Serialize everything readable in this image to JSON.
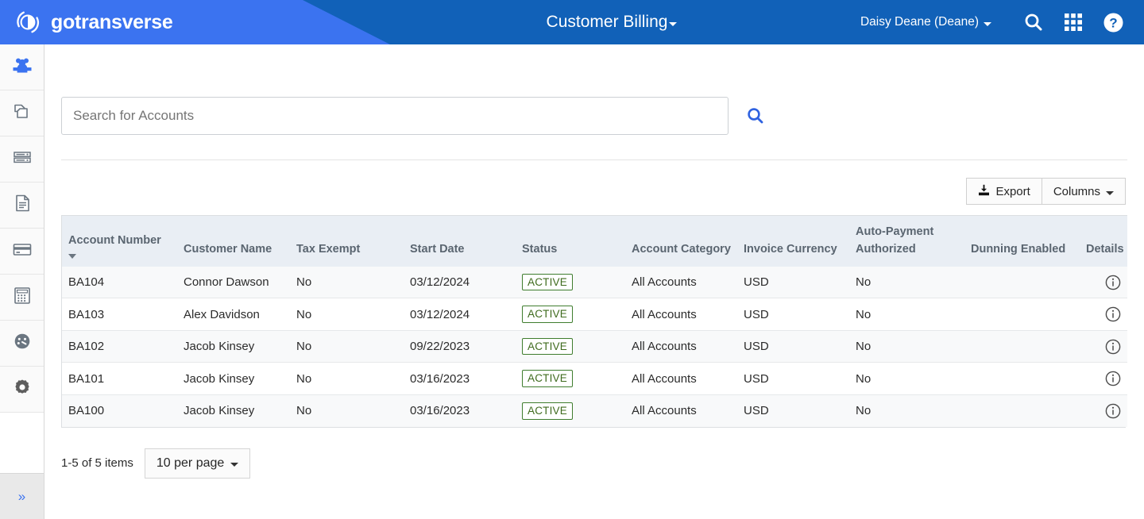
{
  "header": {
    "brand_name": "gotransverse",
    "brand_logo_icon": "gotransverse-ring-logo",
    "title": "Customer Billing",
    "title_caret_icon": "chevron-down-icon",
    "user_name": "Daisy Deane (Deane)",
    "user_caret_icon": "chevron-down-icon",
    "search_icon": "search-icon",
    "apps_icon": "grid-apps-icon",
    "help_icon": "help-circle-icon",
    "colors": {
      "light_blue": "#3b73f0",
      "dark_blue": "#1161b8"
    }
  },
  "sidebar": {
    "items": [
      {
        "icon": "users-group-icon",
        "active": true
      },
      {
        "icon": "copy-documents-icon",
        "active": false
      },
      {
        "icon": "server-stack-icon",
        "active": false
      },
      {
        "icon": "document-icon",
        "active": false
      },
      {
        "icon": "credit-card-icon",
        "active": false
      },
      {
        "icon": "calculator-icon",
        "active": false
      },
      {
        "icon": "gauge-dashboard-icon",
        "active": false
      },
      {
        "icon": "gear-settings-icon",
        "active": false
      }
    ],
    "expand_toggle": {
      "icon": "double-chevron-right-icon",
      "glyph": "»"
    }
  },
  "search": {
    "placeholder": "Search for Accounts",
    "value": "",
    "submit_icon": "search-icon"
  },
  "toolbar": {
    "export_label": "Export",
    "export_icon": "download-icon",
    "columns_label": "Columns",
    "columns_caret_icon": "chevron-down-icon"
  },
  "table": {
    "columns": [
      {
        "label": "Account Number",
        "sorted": true,
        "sort_icon": "sort-descending-caret"
      },
      {
        "label": "Customer Name",
        "sorted": false
      },
      {
        "label": "Tax Exempt",
        "sorted": false
      },
      {
        "label": "Start Date",
        "sorted": false
      },
      {
        "label": "Status",
        "sorted": false
      },
      {
        "label": "Account Category",
        "sorted": false
      },
      {
        "label": "Invoice Currency",
        "sorted": false
      },
      {
        "label": "Auto-Payment Authorized",
        "sorted": false
      },
      {
        "label": "Dunning Enabled",
        "sorted": false
      },
      {
        "label": "Details",
        "sorted": false
      }
    ],
    "rows": [
      {
        "account_number": "BA104",
        "customer_name": "Connor Dawson",
        "tax_exempt": "No",
        "start_date": "03/12/2024",
        "status": "ACTIVE",
        "account_category": "All Accounts",
        "invoice_currency": "USD",
        "auto_payment_authorized": "No",
        "dunning_enabled": "",
        "details_icon": "info-circle-icon"
      },
      {
        "account_number": "BA103",
        "customer_name": "Alex Davidson",
        "tax_exempt": "No",
        "start_date": "03/12/2024",
        "status": "ACTIVE",
        "account_category": "All Accounts",
        "invoice_currency": "USD",
        "auto_payment_authorized": "No",
        "dunning_enabled": "",
        "details_icon": "info-circle-icon"
      },
      {
        "account_number": "BA102",
        "customer_name": "Jacob Kinsey",
        "tax_exempt": "No",
        "start_date": "09/22/2023",
        "status": "ACTIVE",
        "account_category": "All Accounts",
        "invoice_currency": "USD",
        "auto_payment_authorized": "No",
        "dunning_enabled": "",
        "details_icon": "info-circle-icon"
      },
      {
        "account_number": "BA101",
        "customer_name": "Jacob Kinsey",
        "tax_exempt": "No",
        "start_date": "03/16/2023",
        "status": "ACTIVE",
        "account_category": "All Accounts",
        "invoice_currency": "USD",
        "auto_payment_authorized": "No",
        "dunning_enabled": "",
        "details_icon": "info-circle-icon"
      },
      {
        "account_number": "BA100",
        "customer_name": "Jacob Kinsey",
        "tax_exempt": "No",
        "start_date": "03/16/2023",
        "status": "ACTIVE",
        "account_category": "All Accounts",
        "invoice_currency": "USD",
        "auto_payment_authorized": "No",
        "dunning_enabled": "",
        "details_icon": "info-circle-icon"
      }
    ],
    "status_badge_colors": {
      "border": "#3f7d2e",
      "text": "#3f6b1e"
    }
  },
  "pagination": {
    "items_range": "1-5 of 5 items",
    "per_page_label": "10 per page",
    "per_page_caret_icon": "chevron-down-icon"
  }
}
